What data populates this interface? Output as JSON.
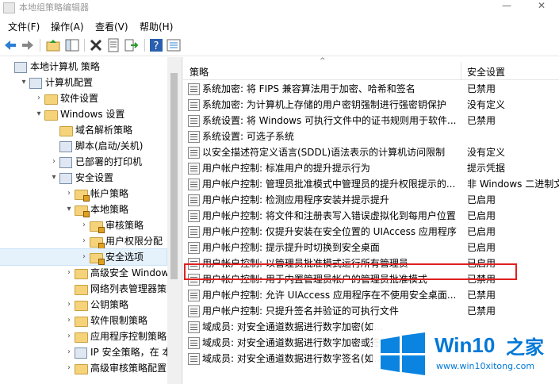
{
  "window": {
    "title": "本地组策略编辑器",
    "minimize": "—",
    "close": "✕"
  },
  "menu": [
    "文件(F)",
    "操作(A)",
    "查看(V)",
    "帮助(H)"
  ],
  "toolbar": [
    "back-icon",
    "forward-icon",
    "up-folder-icon",
    "show-hide-tree-icon",
    "delete-icon",
    "properties-icon",
    "export-icon",
    "help-icon",
    "view-icon"
  ],
  "tree": [
    {
      "label": "本地计算机 策略",
      "indent": 0,
      "twist": "",
      "icon": "policy"
    },
    {
      "label": "计算机配置",
      "indent": 1,
      "twist": "▾",
      "icon": "computer"
    },
    {
      "label": "软件设置",
      "indent": 2,
      "twist": "›",
      "icon": "folder"
    },
    {
      "label": "Windows 设置",
      "indent": 2,
      "twist": "▾",
      "icon": "folder"
    },
    {
      "label": "域名解析策略",
      "indent": 3,
      "twist": "",
      "icon": "folder"
    },
    {
      "label": "脚本(启动/关机)",
      "indent": 3,
      "twist": "",
      "icon": "script"
    },
    {
      "label": "已部署的打印机",
      "indent": 3,
      "twist": "›",
      "icon": "printer"
    },
    {
      "label": "安全设置",
      "indent": 3,
      "twist": "▾",
      "icon": "security"
    },
    {
      "label": "帐户策略",
      "indent": 4,
      "twist": "›",
      "icon": "folder-lock"
    },
    {
      "label": "本地策略",
      "indent": 4,
      "twist": "▾",
      "icon": "folder-lock"
    },
    {
      "label": "审核策略",
      "indent": 5,
      "twist": "›",
      "icon": "folder-lock"
    },
    {
      "label": "用户权限分配",
      "indent": 5,
      "twist": "›",
      "icon": "folder-lock"
    },
    {
      "label": "安全选项",
      "indent": 5,
      "twist": "›",
      "icon": "folder-lock",
      "selected": true
    },
    {
      "label": "高级安全 Windows",
      "indent": 4,
      "twist": "›",
      "icon": "folder"
    },
    {
      "label": "网络列表管理器策略",
      "indent": 4,
      "twist": "",
      "icon": "folder"
    },
    {
      "label": "公钥策略",
      "indent": 4,
      "twist": "›",
      "icon": "folder"
    },
    {
      "label": "软件限制策略",
      "indent": 4,
      "twist": "›",
      "icon": "folder"
    },
    {
      "label": "应用程序控制策略",
      "indent": 4,
      "twist": "›",
      "icon": "folder"
    },
    {
      "label": "IP 安全策略，在 本地",
      "indent": 4,
      "twist": "›",
      "icon": "ip"
    },
    {
      "label": "高级审核策略配置",
      "indent": 4,
      "twist": "›",
      "icon": "folder"
    }
  ],
  "list": {
    "col_policy": "策略",
    "col_setting": "安全设置",
    "sort_indicator": "^",
    "rows": [
      {
        "name": "系统加密: 将 FIPS 兼容算法用于加密、哈希和签名",
        "value": "已禁用"
      },
      {
        "name": "系统加密: 为计算机上存储的用户密钥强制进行强密钥保护",
        "value": "没有定义"
      },
      {
        "name": "系统设置: 将 Windows 可执行文件中的证书规则用于软件...",
        "value": "已禁用"
      },
      {
        "name": "系统设置: 可选子系统",
        "value": ""
      },
      {
        "name": "以安全描述符定义语言(SDDL)语法表示的计算机访问限制",
        "value": "没有定义"
      },
      {
        "name": "用户帐户控制: 标准用户的提升提示行为",
        "value": "提示凭据"
      },
      {
        "name": "用户帐户控制: 管理员批准模式中管理员的提升权限提示的...",
        "value": "非 Windows 二进制文"
      },
      {
        "name": "用户帐户控制: 检测应用程序安装并提示提升",
        "value": "已启用"
      },
      {
        "name": "用户帐户控制: 将文件和注册表写入错误虚拟化到每用户位置",
        "value": "已启用"
      },
      {
        "name": "用户帐户控制: 仅提升安装在安全位置的 UIAccess 应用程序",
        "value": "已启用"
      },
      {
        "name": "用户帐户控制: 提示提升时切换到安全桌面",
        "value": "已启用"
      },
      {
        "name": "用户帐户控制: 以管理员批准模式运行所有管理员",
        "value": "已启用",
        "highlight": true
      },
      {
        "name": "用户帐户控制: 用于内置管理员帐户的管理员批准模式",
        "value": "已禁用"
      },
      {
        "name": "用户帐户控制: 允许 UIAccess 应用程序在不使用安全桌面...",
        "value": "已禁用"
      },
      {
        "name": "用户帐户控制: 只提升签名并验证的可执行文件",
        "value": "已禁用"
      },
      {
        "name": "域成员: 对安全通道数据进行数字加密(如...",
        "value": ""
      },
      {
        "name": "域成员: 对安全通道数据进行数字加密或签...",
        "value": ""
      },
      {
        "name": "域成员: 对安全通道数据进行数字签名(如...",
        "value": ""
      }
    ]
  },
  "watermark": {
    "brand": "Win10",
    "brand_suffix": "之家",
    "url": "www.win10xitong.com"
  }
}
